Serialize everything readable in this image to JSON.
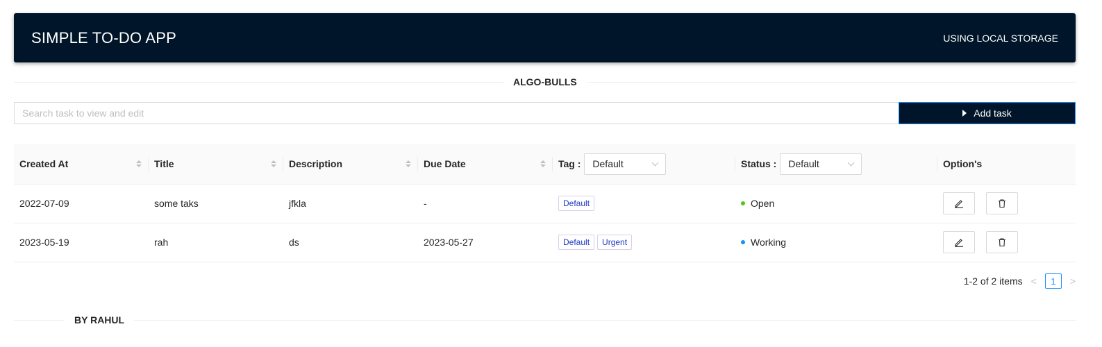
{
  "header": {
    "title": "SIMPLE TO-DO APP",
    "subtitle": "USING LOCAL STORAGE",
    "background": "#001529"
  },
  "section_divider": {
    "label": "ALGO-BULLS"
  },
  "search": {
    "placeholder": "Search task to view and edit",
    "value": ""
  },
  "add_button": {
    "label": "Add task",
    "icon": "caret-right-icon"
  },
  "table": {
    "columns": {
      "created_at": "Created At",
      "title": "Title",
      "description": "Description",
      "due_date": "Due Date",
      "tag": "Tag :",
      "status": "Status :",
      "options": "Option's"
    },
    "tag_filter": {
      "selected": "Default"
    },
    "status_filter": {
      "selected": "Default"
    },
    "rows": [
      {
        "created_at": "2022-07-09",
        "title": "some taks",
        "description": "jfkla",
        "due_date": "-",
        "tags": [
          "Default"
        ],
        "status": "Open",
        "status_color": "#52c41a"
      },
      {
        "created_at": "2023-05-19",
        "title": "rah",
        "description": "ds",
        "due_date": "2023-05-27",
        "tags": [
          "Default",
          "Urgent"
        ],
        "status": "Working",
        "status_color": "#1890ff"
      }
    ],
    "row_actions": {
      "edit_icon": "edit-icon",
      "delete_icon": "delete-icon"
    }
  },
  "pagination": {
    "summary": "1-2 of 2 items",
    "current_page": "1",
    "prev": "<",
    "next": ">"
  },
  "footer_divider": {
    "label": "BY RAHUL"
  },
  "colors": {
    "accent": "#1890ff",
    "dark": "#001529",
    "tag_text": "#1d39c4"
  }
}
